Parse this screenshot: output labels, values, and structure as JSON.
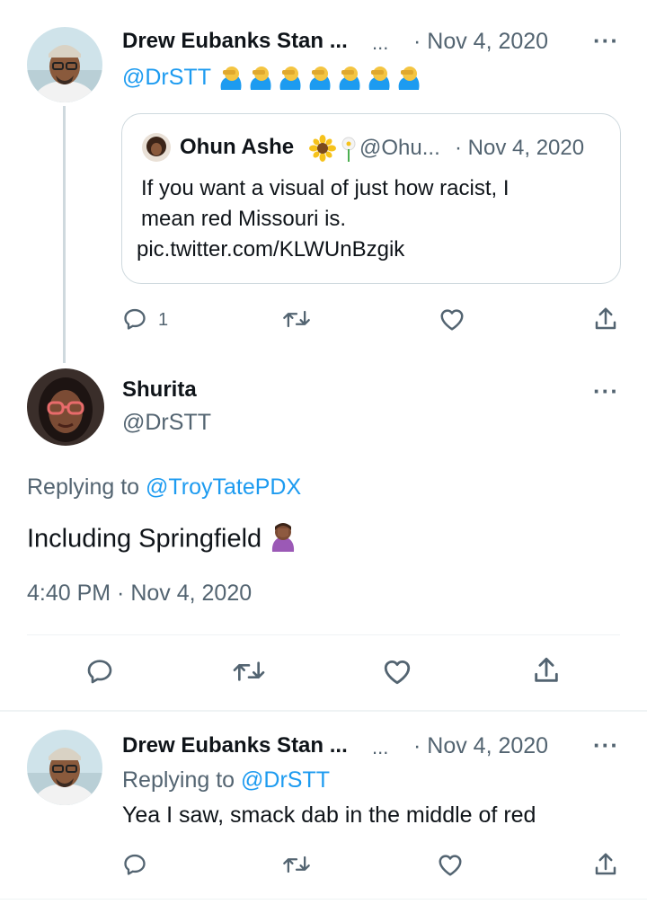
{
  "tweet1": {
    "display_name": "Drew Eubanks Stan ...",
    "ellipsis": "...",
    "date": "· Nov 4, 2020",
    "handle": "@DrSTT",
    "emoji_count": 7,
    "reply_count": "1",
    "quote": {
      "display_name": "Ohun Ashe",
      "handle": "@Ohu...",
      "date": "· Nov 4, 2020",
      "text_line1": "If you want a visual of just how racist, I",
      "text_line2": "mean red Missouri is.",
      "text_line3": "pic.twitter.com/KLWUnBzgik"
    }
  },
  "main_tweet": {
    "display_name": "Shurita",
    "handle": "@DrSTT",
    "replying_prefix": "Replying to ",
    "replying_to": "@TroyTatePDX",
    "text": "Including Springfield",
    "timestamp": "4:40 PM · Nov 4, 2020"
  },
  "tweet3": {
    "display_name": "Drew Eubanks Stan ...",
    "ellipsis": "...",
    "date": "· Nov 4, 2020",
    "replying_prefix": "Replying to ",
    "replying_to": "@DrSTT",
    "text": "Yea I saw, smack dab in the middle of red"
  },
  "icons": {
    "reply": "reply-icon",
    "retweet": "retweet-icon",
    "like": "heart-icon",
    "share": "share-icon",
    "more": "more-icon"
  },
  "colors": {
    "link": "#1d9bf0",
    "muted": "#536471",
    "text": "#0f1419",
    "thread_line": "#cfd9de"
  }
}
